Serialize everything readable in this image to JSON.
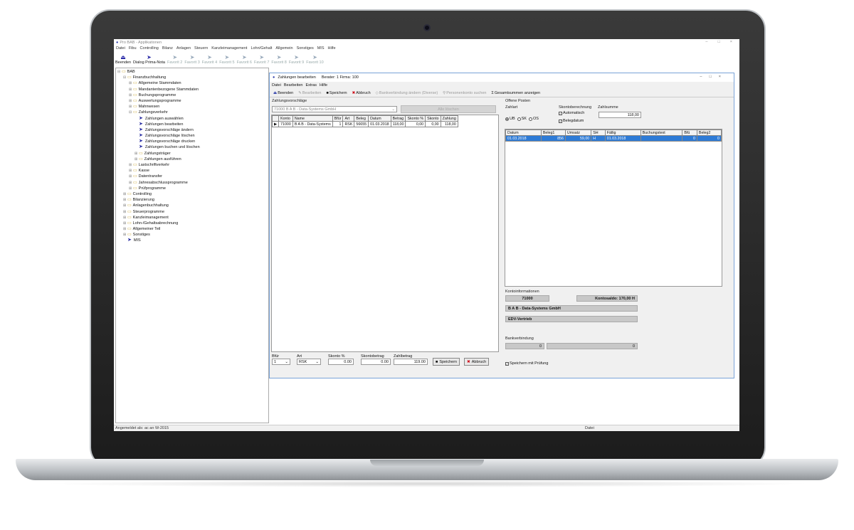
{
  "app": {
    "title": "Pro BAB - Applikationen",
    "window_controls": [
      "–",
      "□",
      "×"
    ],
    "menu": [
      "Datei",
      "Fibu",
      "Controlling",
      "Bilanz",
      "Anlagen",
      "Steuern",
      "Kanzleimanagement",
      "Lohn/Gehalt",
      "Allgemein",
      "Sonstiges",
      "MIS",
      "Hilfe"
    ],
    "toolbar": [
      {
        "label": "Beenden",
        "icon": "exit-icon",
        "active": true
      },
      {
        "label": "Dialog Prima-Nota",
        "icon": "arrow-icon",
        "active": true
      },
      {
        "label": "Favorit 2"
      },
      {
        "label": "Favorit 3"
      },
      {
        "label": "Favorit 4"
      },
      {
        "label": "Favorit 5"
      },
      {
        "label": "Favorit 6"
      },
      {
        "label": "Favorit 7"
      },
      {
        "label": "Favorit 8"
      },
      {
        "label": "Favorit 9"
      },
      {
        "label": "Favorit 10"
      }
    ],
    "status_left": "Angemeldet als: ac an W-2015",
    "status_right": "Datei"
  },
  "tree": [
    {
      "l": 0,
      "t": "BAB",
      "icon": "folder",
      "exp": "-"
    },
    {
      "l": 1,
      "t": "Finanzbuchhaltung",
      "icon": "folder",
      "exp": "-"
    },
    {
      "l": 2,
      "t": "Allgemeine Stammdaten",
      "icon": "folder",
      "exp": "+"
    },
    {
      "l": 2,
      "t": "Mandantenbezogene Stammdaten",
      "icon": "folder",
      "exp": "+"
    },
    {
      "l": 2,
      "t": "Buchungsprogramme",
      "icon": "folder",
      "exp": "+"
    },
    {
      "l": 2,
      "t": "Auswertungsprogramme",
      "icon": "folder",
      "exp": "+"
    },
    {
      "l": 2,
      "t": "Mahnwesen",
      "icon": "folder",
      "exp": "+"
    },
    {
      "l": 2,
      "t": "Zahlungsverkehr",
      "icon": "folder",
      "exp": "-"
    },
    {
      "l": 3,
      "t": "Zahlungen auswählen",
      "icon": "arrow"
    },
    {
      "l": 3,
      "t": "Zahlungen bearbeiten",
      "icon": "arrow"
    },
    {
      "l": 3,
      "t": "Zahlungsvorschläge ändern",
      "icon": "arrow"
    },
    {
      "l": 3,
      "t": "Zahlungsvorschläge löschen",
      "icon": "arrow"
    },
    {
      "l": 3,
      "t": "Zahlungsvorschläge drucken",
      "icon": "arrow"
    },
    {
      "l": 3,
      "t": "Zahlungen buchen und löschen",
      "icon": "arrow"
    },
    {
      "l": 3,
      "t": "Zahlungsträger",
      "icon": "folder",
      "exp": "+"
    },
    {
      "l": 3,
      "t": "Zahlungen ausführen",
      "icon": "folder",
      "exp": "+"
    },
    {
      "l": 2,
      "t": "Lastschriftverkehr",
      "icon": "folder",
      "exp": "+"
    },
    {
      "l": 2,
      "t": "Kasse",
      "icon": "folder",
      "exp": "+"
    },
    {
      "l": 2,
      "t": "Datentransfer",
      "icon": "folder",
      "exp": "+"
    },
    {
      "l": 2,
      "t": "Jahresabschlussprogramme",
      "icon": "folder",
      "exp": "+"
    },
    {
      "l": 2,
      "t": "Prüfprogramme",
      "icon": "folder",
      "exp": "+"
    },
    {
      "l": 1,
      "t": "Controlling",
      "icon": "folder",
      "exp": "+"
    },
    {
      "l": 1,
      "t": "Bilanzierung",
      "icon": "folder",
      "exp": "+"
    },
    {
      "l": 1,
      "t": "Anlagenbuchhaltung",
      "icon": "folder",
      "exp": "+"
    },
    {
      "l": 1,
      "t": "Steuerprogramme",
      "icon": "folder",
      "exp": "+"
    },
    {
      "l": 1,
      "t": "Kanzleimanagement",
      "icon": "folder",
      "exp": "+"
    },
    {
      "l": 1,
      "t": "Lohn-/Gehaltsabrechnung",
      "icon": "folder",
      "exp": "+"
    },
    {
      "l": 1,
      "t": "Allgemeiner Teil",
      "icon": "folder",
      "exp": "+"
    },
    {
      "l": 1,
      "t": "Sonstiges",
      "icon": "folder",
      "exp": "+"
    },
    {
      "l": 1,
      "t": "MIS",
      "icon": "arrow"
    }
  ],
  "dialog": {
    "title": "Zahlungen bearbeiten",
    "subtitle": "Berater: 1 Firma: 100",
    "menu": [
      "Datei",
      "Bearbeiten",
      "Extras",
      "Hilfe"
    ],
    "toolbar": {
      "beenden": "Beenden",
      "bearbeiten": "Bearbeiten",
      "speichern": "Speichern",
      "abbruch": "Abbruch",
      "bankverbindung": "Bankverbindung ändern (Diverse)",
      "personenkonto": "Personenkonto suchen",
      "summen": "Gesamtsummen anzeigen"
    },
    "vorschlaege_label": "Zahlungsvorschläge",
    "vorschlaege_select": "71000  B A B - Data-Systems GmbH",
    "grey_button": "Alle löschen",
    "table": {
      "headers": [
        "Konto",
        "Name",
        "Bfür",
        "Art",
        "Beleg",
        "Datum",
        "Betrag",
        "Skonto %",
        "Skonto",
        "Zahlung"
      ],
      "rows": [
        [
          "71000",
          "B A B - Data-Systems",
          "1",
          "RSK",
          "56655",
          "01.03.2018",
          "118,00",
          "0,00",
          "0,00",
          "118,00"
        ]
      ]
    },
    "bottom": {
      "bfuer_label": "Bfür",
      "bfuer_value": "1",
      "art_label": "Art",
      "art_value": "RSK",
      "skonto_pct_label": "Skonto %",
      "skonto_pct_value": "0.00",
      "skontobetrag_label": "Skontobetrag",
      "skontobetrag_value": "0.00",
      "zahlbetrag_label": "Zahlbetrag",
      "zahlbetrag_value": "119.00",
      "speichern": "Speichern",
      "abbruch": "Abbruch"
    },
    "op": {
      "title": "Offene Posten",
      "zahlart_label": "Zahlart",
      "radios": [
        "UB",
        "SK",
        "OS"
      ],
      "skonto_label": "Skontoberechnung",
      "auto": "Automatisch",
      "belegdatum": "Belegdatum",
      "zahlsumme_label": "Zahlsumme",
      "zahlsumme_value": "118,00",
      "headers": [
        "Datum",
        "Beleg1",
        "Umsatz",
        "SH",
        "Fällig",
        "Buchungstext",
        "Bfü",
        "Beleg2"
      ],
      "rows": [
        [
          "01.03.2018",
          "856",
          "59,00",
          "H",
          "01.03.2018",
          "",
          "0",
          "0"
        ]
      ]
    },
    "konto": {
      "title": "Kontoinformationen",
      "nr": "71000",
      "saldo": "Kontosaldo: 170,00 H",
      "name": "B A B - Data-Systems GmbH",
      "gruppe": "EDV-Vertrieb"
    },
    "bank": {
      "title": "Bankverbindung",
      "left": "0",
      "right": "0"
    },
    "pruefung": "Speichern mit Prüfung"
  }
}
